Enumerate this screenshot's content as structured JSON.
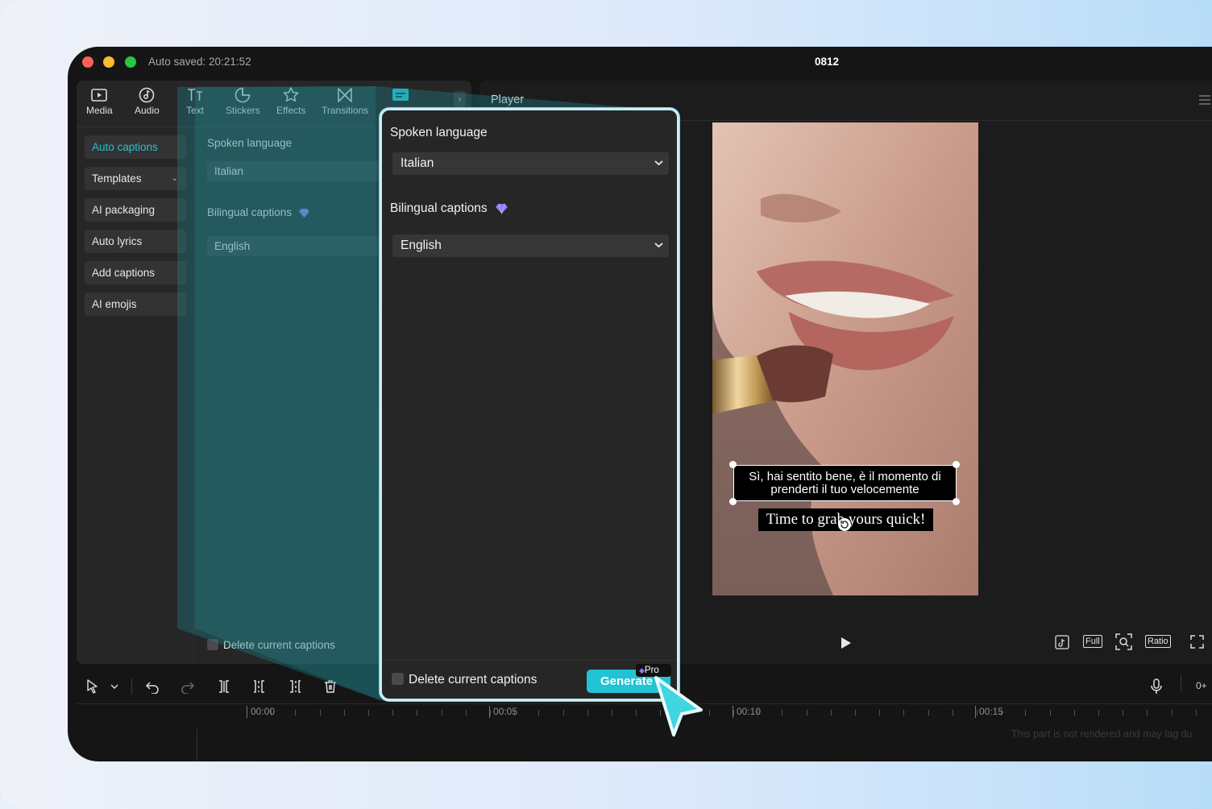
{
  "window": {
    "autosave": "Auto saved: 20:21:52",
    "project_name": "0812"
  },
  "toolbar": {
    "items": [
      {
        "label": "Media",
        "icon": "media-icon"
      },
      {
        "label": "Audio",
        "icon": "audio-icon"
      },
      {
        "label": "Text",
        "icon": "text-icon"
      },
      {
        "label": "Stickers",
        "icon": "stickers-icon"
      },
      {
        "label": "Effects",
        "icon": "effects-icon"
      },
      {
        "label": "Transitions",
        "icon": "transitions-icon"
      }
    ]
  },
  "sidebar": {
    "items": [
      {
        "label": "Auto captions",
        "active": true
      },
      {
        "label": "Templates"
      },
      {
        "label": "AI packaging"
      },
      {
        "label": "Auto lyrics"
      },
      {
        "label": "Add captions"
      },
      {
        "label": "AI emojis"
      }
    ]
  },
  "captions_panel": {
    "spoken_language_label": "Spoken language",
    "spoken_language_value": "Italian",
    "bilingual_label": "Bilingual captions",
    "bilingual_value": "English",
    "delete_label": "Delete current captions",
    "generate_label": "Generate",
    "pro_badge": "Pro"
  },
  "player": {
    "title": "Player",
    "caption_primary": "Sì, hai sentito bene, è il momento di prenderti il tuo velocemente",
    "caption_secondary": "Time to grab yours quick!",
    "controls": {
      "full": "Full",
      "ratio": "Ratio"
    }
  },
  "timeline": {
    "labels": [
      "00:00",
      "00:05",
      "00:10",
      "00:15"
    ],
    "note": "This part is not rendered and may lag du",
    "zoom_label": "0+"
  },
  "colors": {
    "accent": "#22c3d3",
    "premium": "#8b7cf6"
  }
}
